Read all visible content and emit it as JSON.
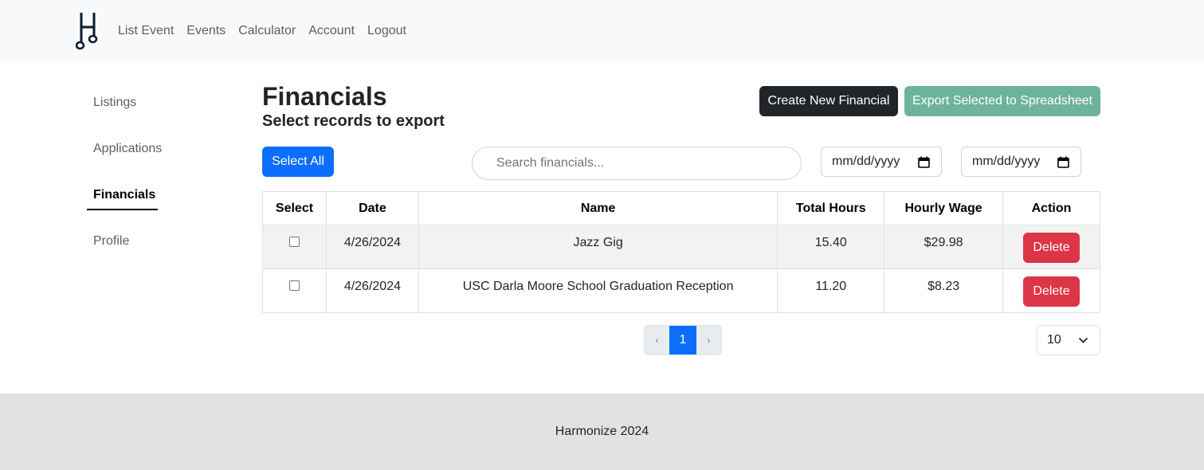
{
  "navbar": {
    "logo_icon": "music-note-h-logo",
    "links": [
      "List Event",
      "Events",
      "Calculator",
      "Account",
      "Logout"
    ]
  },
  "sidebar": {
    "items": [
      {
        "label": "Listings",
        "active": false
      },
      {
        "label": "Applications",
        "active": false
      },
      {
        "label": "Financials",
        "active": true
      },
      {
        "label": "Profile",
        "active": false
      }
    ]
  },
  "header": {
    "title": "Financials",
    "subtitle": "Select records to export",
    "create_label": "Create New Financial",
    "export_label": "Export Selected to Spreadsheet"
  },
  "toolbar": {
    "select_all_label": "Select All",
    "search_placeholder": "Search financials...",
    "date_from_placeholder": "mm/dd/yyyy",
    "date_to_placeholder": "mm/dd/yyyy"
  },
  "table": {
    "columns": [
      "Select",
      "Date",
      "Name",
      "Total Hours",
      "Hourly Wage",
      "Action"
    ],
    "rows": [
      {
        "checked": false,
        "date": "4/26/2024",
        "name": "Jazz Gig",
        "total_hours": "15.40",
        "hourly_wage": "$29.98",
        "action": "Delete"
      },
      {
        "checked": false,
        "date": "4/26/2024",
        "name": "USC Darla Moore School Graduation Reception",
        "total_hours": "11.20",
        "hourly_wage": "$8.23",
        "action": "Delete"
      }
    ]
  },
  "pagination": {
    "prev": "‹",
    "current_page": "1",
    "next": "›",
    "page_size": "10"
  },
  "footer": {
    "text": "Harmonize 2024"
  },
  "colors": {
    "primary": "#0d6efd",
    "dark": "#212529",
    "export": "#6db39a",
    "danger": "#dc3545"
  }
}
